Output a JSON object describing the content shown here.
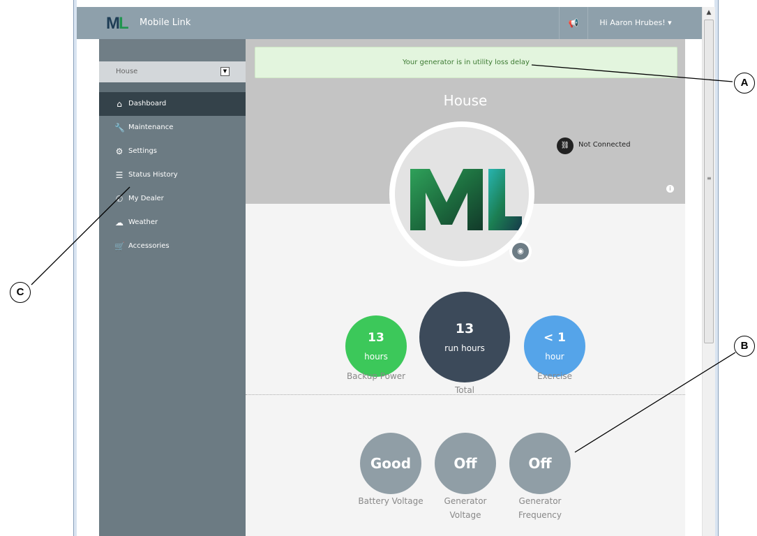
{
  "navbar": {
    "logo_text": "ML",
    "brand": "Mobile Link",
    "announcement_icon": "megaphone-icon",
    "user_greeting": "Hi Aaron Hrubes! ▾"
  },
  "sidebar": {
    "generator_select": "House",
    "items": [
      {
        "label": "Dashboard",
        "icon": "home-icon",
        "glyph": "⌂",
        "active": true
      },
      {
        "label": "Maintenance",
        "icon": "wrench-icon",
        "glyph": "🔧",
        "active": false
      },
      {
        "label": "Settings",
        "icon": "gears-icon",
        "glyph": "⚙",
        "active": false
      },
      {
        "label": "Status History",
        "icon": "list-icon",
        "glyph": "☰",
        "active": false
      },
      {
        "label": "My Dealer",
        "icon": "phone-icon",
        "glyph": "✆",
        "active": false
      },
      {
        "label": "Weather",
        "icon": "cloud-icon",
        "glyph": "☁",
        "active": false
      },
      {
        "label": "Accessories",
        "icon": "cart-icon",
        "glyph": "🛒",
        "active": false
      }
    ]
  },
  "main": {
    "alert": "Your generator is in utility loss delay",
    "generator_name": "House",
    "connection_status": "Not Connected",
    "stats": {
      "backup": {
        "value": "13",
        "unit": "hours",
        "label": "Backup Power"
      },
      "total": {
        "value": "13",
        "unit": "run hours",
        "label": "Total"
      },
      "exercise": {
        "value": "< 1",
        "unit": "hour",
        "label": "Exercise"
      }
    },
    "status": {
      "battery": {
        "value": "Good",
        "label": "Battery Voltage"
      },
      "gen_voltage": {
        "value": "Off",
        "label": "Generator Voltage"
      },
      "gen_frequency": {
        "value": "Off",
        "label": "Generator Frequency"
      }
    }
  },
  "callouts": {
    "a": "A",
    "b": "B",
    "c": "C"
  },
  "colors": {
    "navbar": "#8ea0ab",
    "sidebar": "#6c7b83",
    "active_nav": "#34424a",
    "backup": "#3cc85a",
    "total": "#3c4a5a",
    "exercise": "#55a4e9",
    "status_circle": "#909ea6",
    "alert_bg": "#e3f5de"
  }
}
